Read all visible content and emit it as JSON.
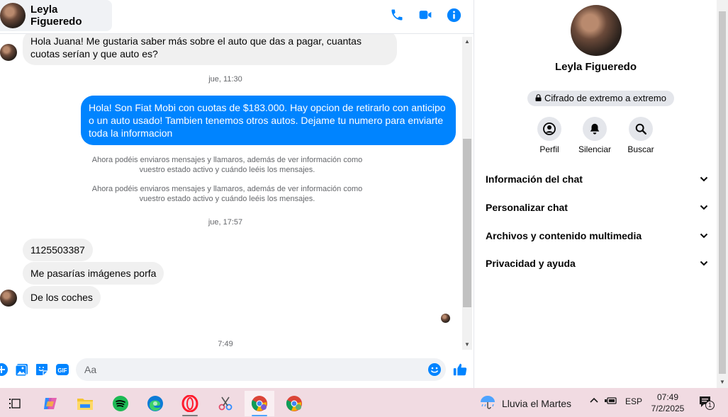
{
  "chat": {
    "contact_name": "Leyla Figueredo",
    "messages": [
      {
        "id": "m1",
        "direction": "in",
        "text": "Hola Juana! Me gustaria saber más sobre el auto que das a pagar, cuantas cuotas serían y que auto es?"
      },
      {
        "id": "sep1",
        "type": "time",
        "text": "jue, 11:30"
      },
      {
        "id": "m2",
        "direction": "out",
        "text": "Hola! Son Fiat Mobi con cuotas de $183.000. Hay opcion de retirarlo con anticipo o un auto usado! Tambien tenemos otros autos. Dejame tu numero para enviarte toda la informacion"
      },
      {
        "id": "sys1",
        "type": "system",
        "text": "Ahora podéis enviaros mensajes y llamaros, además de ver información como vuestro estado activo y cuándo leéis los mensajes."
      },
      {
        "id": "sys2",
        "type": "system",
        "text": "Ahora podéis enviaros mensajes y llamaros, además de ver información como vuestro estado activo y cuándo leéis los mensajes."
      },
      {
        "id": "sep2",
        "type": "time",
        "text": "jue, 17:57"
      },
      {
        "id": "m3",
        "direction": "in",
        "text": "1125503387"
      },
      {
        "id": "m4",
        "direction": "in",
        "text": "Me pasarías imágenes porfa"
      },
      {
        "id": "m5",
        "direction": "in",
        "text": "De los coches"
      },
      {
        "id": "sep3",
        "type": "time",
        "text": "7:49"
      }
    ],
    "composer": {
      "placeholder": "Aa"
    }
  },
  "info_panel": {
    "name": "Leyla Figueredo",
    "encryption_badge": "Cifrado de extremo a extremo",
    "actions": [
      {
        "label": "Perfil",
        "icon": "profile-icon"
      },
      {
        "label": "Silenciar",
        "icon": "bell-icon"
      },
      {
        "label": "Buscar",
        "icon": "search-icon"
      }
    ],
    "sections": [
      {
        "label": "Información del chat"
      },
      {
        "label": "Personalizar chat"
      },
      {
        "label": "Archivos y contenido multimedia"
      },
      {
        "label": "Privacidad y ayuda"
      }
    ]
  },
  "taskbar": {
    "weather_text": "Lluvia el Martes",
    "language": "ESP",
    "time": "07:49",
    "date": "7/2/2025",
    "notification_count": "1"
  },
  "colors": {
    "messenger_blue": "#0084ff",
    "incoming_bubble": "#f0f0f0",
    "taskbar": "#f1dbe2"
  }
}
